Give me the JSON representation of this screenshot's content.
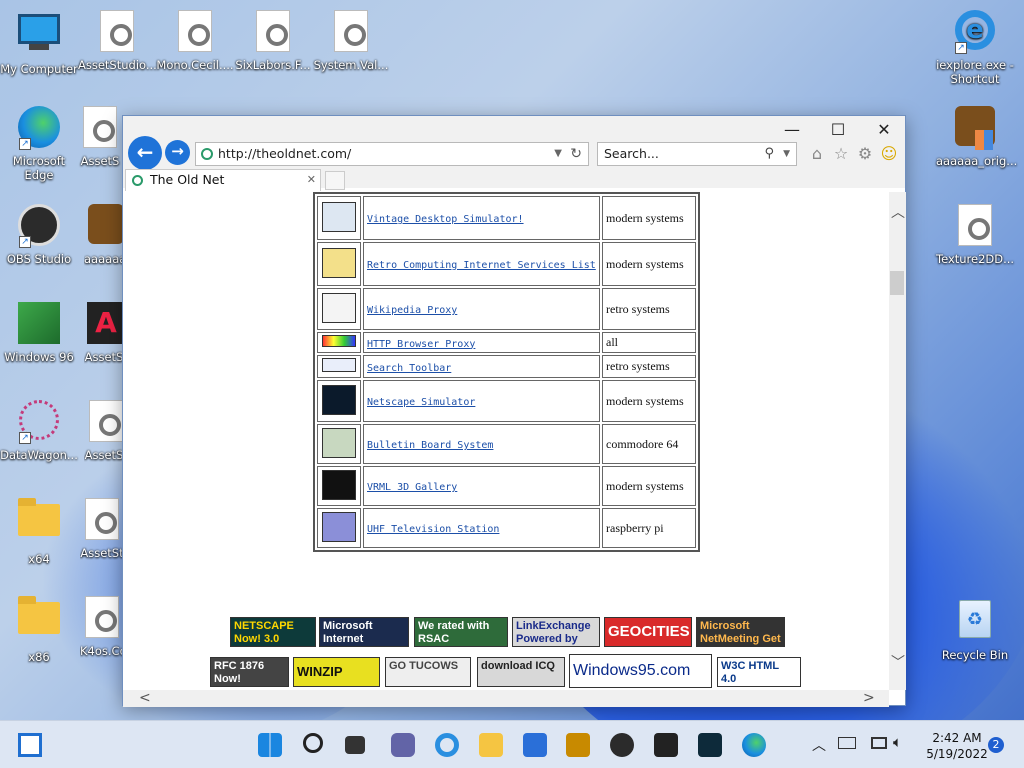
{
  "desktop": {
    "icons": [
      {
        "label": "My Computer"
      },
      {
        "label": "AssetStudio..."
      },
      {
        "label": "Mono.Cecil...."
      },
      {
        "label": "SixLabors.F..."
      },
      {
        "label": "System.Val..."
      },
      {
        "label": "iexplore.exe - Shortcut"
      },
      {
        "label": "Microsoft Edge"
      },
      {
        "label": "AssetS"
      },
      {
        "label": "aaaaaa_orig..."
      },
      {
        "label": "OBS Studio"
      },
      {
        "label": "aaaaaa"
      },
      {
        "label": "Texture2DD..."
      },
      {
        "label": "Windows 96"
      },
      {
        "label": "AssetS"
      },
      {
        "label": "DataWagon..."
      },
      {
        "label": "AssetS"
      },
      {
        "label": "x64"
      },
      {
        "label": "AssetSt"
      },
      {
        "label": "x86"
      },
      {
        "label": "K4os.Co"
      },
      {
        "label": "Recycle Bin"
      }
    ]
  },
  "browser": {
    "url": "http://theoldnet.com/",
    "search_placeholder": "Search...",
    "tab_title": "The Old Net",
    "window_controls": {
      "minimize": "—",
      "maximize": "☐",
      "close": "✕"
    }
  },
  "sites": [
    {
      "name": "Vintage Desktop Simulator!",
      "platform": "modern systems",
      "icon": "desktop-pencil-icon"
    },
    {
      "name": "Retro Computing Internet Services List",
      "platform": "modern systems",
      "icon": "folder-icon"
    },
    {
      "name": "Wikipedia Proxy",
      "platform": "retro systems",
      "icon": "book-icon"
    },
    {
      "name": "HTTP Browser Proxy",
      "platform": "all",
      "icon": "new-badge-icon"
    },
    {
      "name": "Search Toolbar",
      "platform": "retro systems",
      "icon": "pointing-hand-icon"
    },
    {
      "name": "Netscape Simulator",
      "platform": "modern systems",
      "icon": "netscape-n-icon"
    },
    {
      "name": "Bulletin Board System",
      "platform": "commodore 64",
      "icon": "bbs-computers-icon"
    },
    {
      "name": "VRML 3D Gallery",
      "platform": "modern systems",
      "icon": "vrml-icon"
    },
    {
      "name": "UHF Television Station",
      "platform": "raspberry pi",
      "icon": "tv-icon"
    }
  ],
  "badges": {
    "row1": [
      {
        "text": "NETSCAPE Now! 3.0"
      },
      {
        "text": "Microsoft Internet Explorer"
      },
      {
        "text": "We rated with RSAC"
      },
      {
        "text": "LinkExchange Powered by People"
      },
      {
        "text": "GEOCITIES"
      },
      {
        "text": "Microsoft NetMeeting Get it Now!"
      }
    ],
    "row2": [
      {
        "text": "RFC 1876 Now!"
      },
      {
        "text": "WINZIP NOW"
      },
      {
        "text": "GO TUCOWS"
      },
      {
        "text": "download ICQ"
      },
      {
        "text": "Windows95.com"
      },
      {
        "text": "W3C HTML 4.0"
      }
    ]
  },
  "taskbar": {
    "time": "2:42 AM",
    "date": "5/19/2022",
    "notifications": "2"
  },
  "colors": {
    "link": "#1c4fa8",
    "accent": "#1f73d8"
  }
}
